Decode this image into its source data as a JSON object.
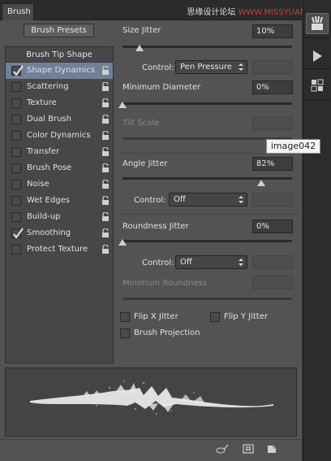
{
  "tab": {
    "label": "Brush"
  },
  "watermark": {
    "text": "思缘设计论坛",
    "url": "WWW.MISSYUAN.COM"
  },
  "left": {
    "presets_button": "Brush Presets",
    "header": "Brush Tip Shape",
    "items": [
      {
        "label": "Shape Dynamics",
        "checked": true,
        "selected": true
      },
      {
        "label": "Scattering",
        "checked": false,
        "selected": false
      },
      {
        "label": "Texture",
        "checked": false,
        "selected": false
      },
      {
        "label": "Dual Brush",
        "checked": false,
        "selected": false
      },
      {
        "label": "Color Dynamics",
        "checked": false,
        "selected": false
      },
      {
        "label": "Transfer",
        "checked": false,
        "selected": false
      },
      {
        "label": "Brush Pose",
        "checked": false,
        "selected": false
      },
      {
        "label": "Noise",
        "checked": false,
        "selected": false
      },
      {
        "label": "Wet Edges",
        "checked": false,
        "selected": false
      },
      {
        "label": "Build-up",
        "checked": false,
        "selected": false
      },
      {
        "label": "Smoothing",
        "checked": true,
        "selected": false
      },
      {
        "label": "Protect Texture",
        "checked": false,
        "selected": false
      }
    ]
  },
  "settings": {
    "size_jitter": {
      "label": "Size Jitter",
      "value": "10%",
      "level": 0.1
    },
    "size_control": {
      "label": "Control:",
      "value": "Pen Pressure"
    },
    "min_diameter": {
      "label": "Minimum Diameter",
      "value": "0%",
      "level": 0
    },
    "tilt_scale": {
      "label": "Tilt Scale"
    },
    "angle_jitter": {
      "label": "Angle Jitter",
      "value": "82%",
      "level": 0.82
    },
    "angle_control": {
      "label": "Control:",
      "value": "Off"
    },
    "roundness_jitter": {
      "label": "Roundness Jitter",
      "value": "0%",
      "level": 0
    },
    "roundness_control": {
      "label": "Control:",
      "value": "Off"
    },
    "min_roundness": {
      "label": "Minimum Roundness"
    },
    "flip_x": {
      "label": "Flip X Jitter",
      "checked": false
    },
    "flip_y": {
      "label": "Flip Y Jitter",
      "checked": false
    },
    "brush_projection": {
      "label": "Brush Projection",
      "checked": false
    }
  },
  "tooltip": {
    "text": "image042"
  },
  "icons": {
    "dock": [
      "brush-panel-icon",
      "play-icon",
      "brush-presets-icon"
    ],
    "bottom": [
      "toggle-bristle-preview-icon",
      "grid-icon",
      "new-brush-icon"
    ]
  },
  "colors": {
    "selected_row": "#6f8199",
    "panel": "#535353"
  }
}
